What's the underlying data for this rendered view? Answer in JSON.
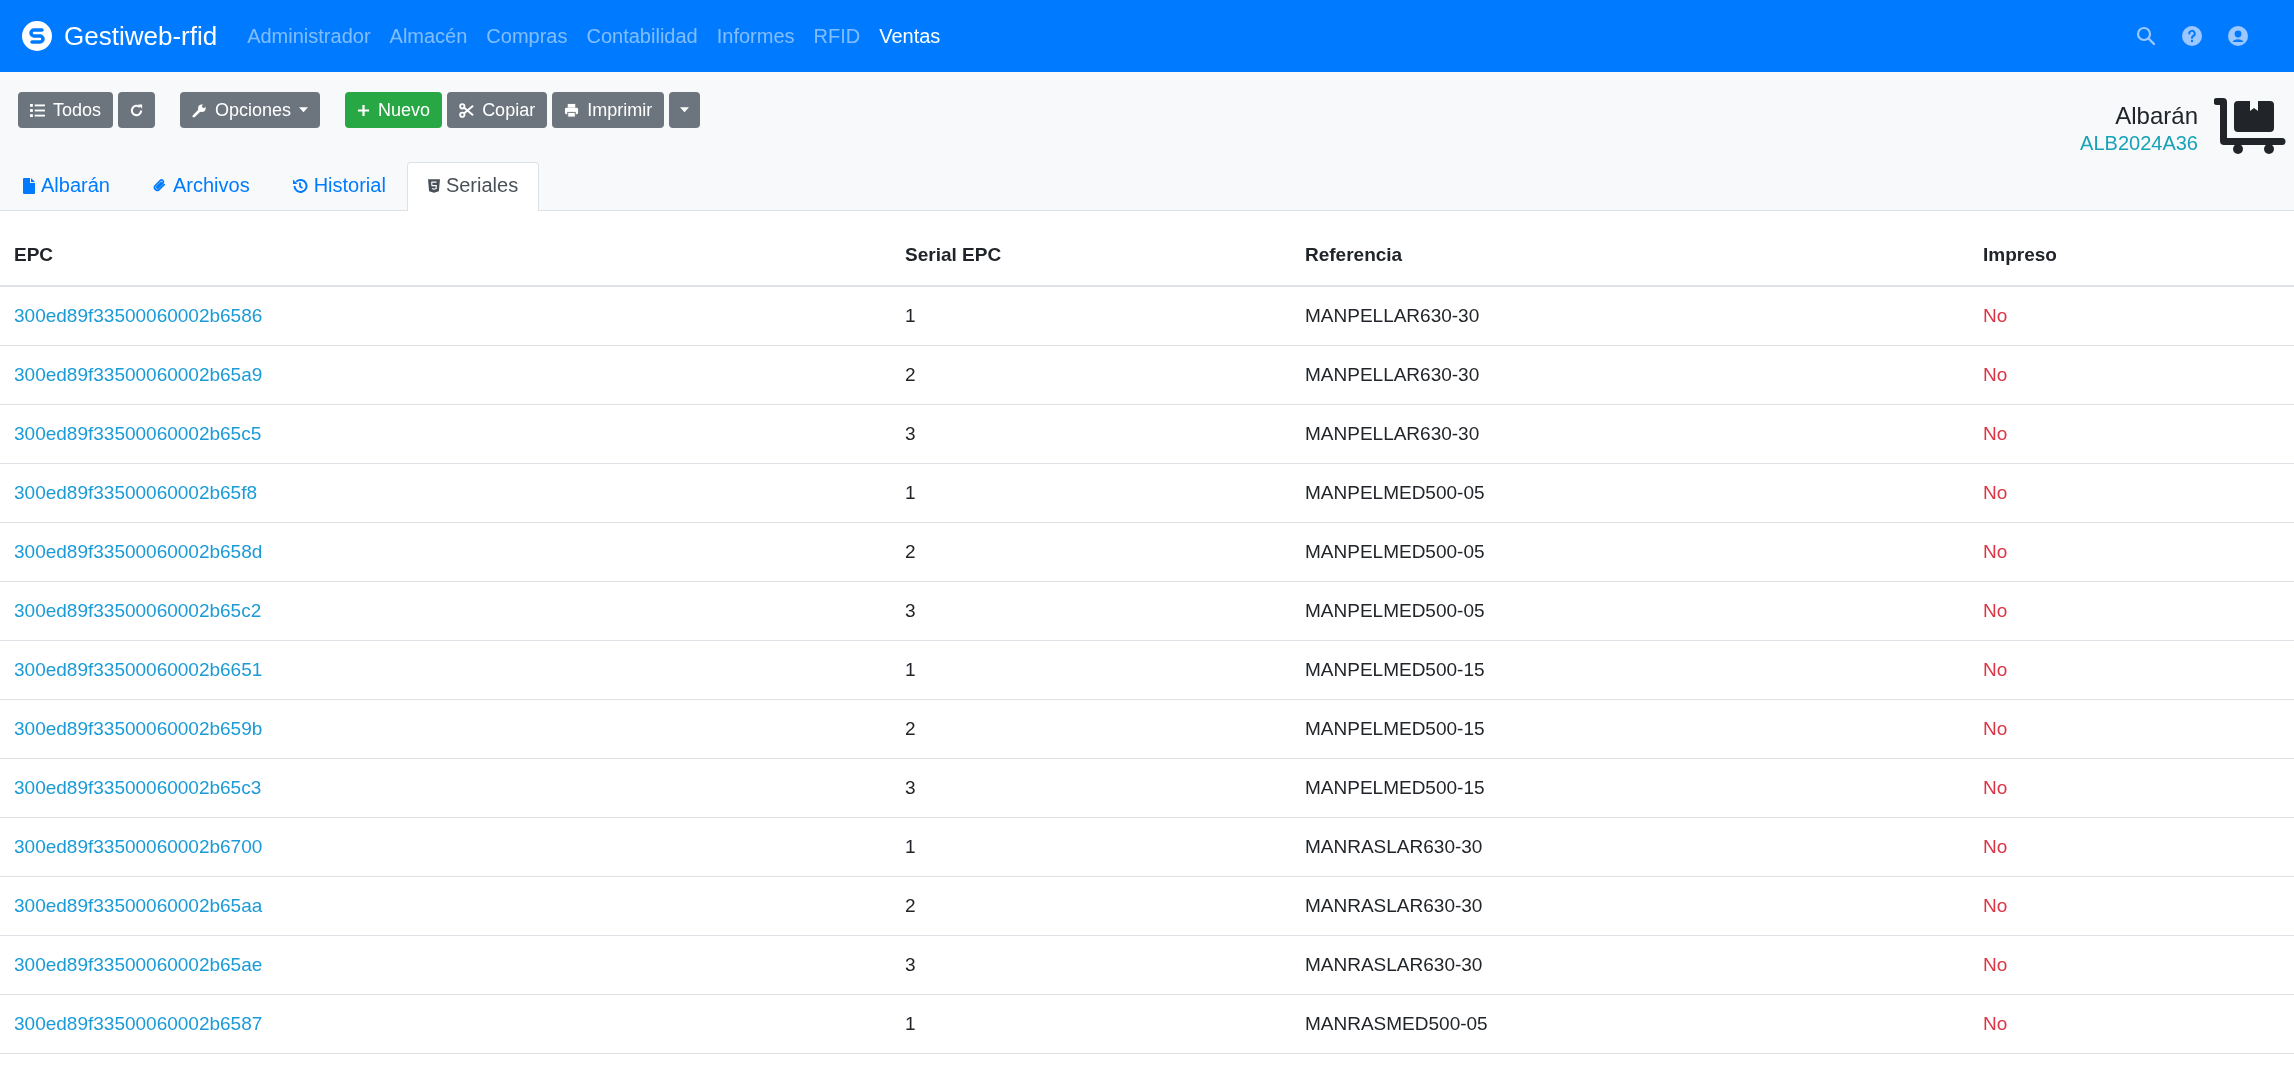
{
  "navbar": {
    "brand": "Gestiweb-rfid",
    "items": [
      {
        "label": "Administrador",
        "selected": false
      },
      {
        "label": "Almacén",
        "selected": false
      },
      {
        "label": "Compras",
        "selected": false
      },
      {
        "label": "Contabilidad",
        "selected": false
      },
      {
        "label": "Informes",
        "selected": false
      },
      {
        "label": "RFID",
        "selected": false
      },
      {
        "label": "Ventas",
        "selected": true
      }
    ]
  },
  "toolbar": {
    "groups": [
      {
        "buttons": [
          {
            "kind": "list",
            "label": "Todos"
          },
          {
            "kind": "refresh"
          }
        ]
      },
      {
        "buttons": [
          {
            "kind": "options",
            "label": "Opciones"
          }
        ]
      },
      {
        "buttons": [
          {
            "kind": "new",
            "label": "Nuevo"
          },
          {
            "kind": "copy",
            "label": "Copiar"
          },
          {
            "kind": "print",
            "label": "Imprimir"
          },
          {
            "kind": "caret"
          }
        ]
      }
    ]
  },
  "document": {
    "title": "Albarán",
    "code": "ALB2024A36"
  },
  "tabs": [
    {
      "kind": "file",
      "label": "Albarán",
      "selected": false
    },
    {
      "kind": "clip",
      "label": "Archivos",
      "selected": false
    },
    {
      "kind": "history",
      "label": "Historial",
      "selected": false
    },
    {
      "kind": "html5",
      "label": "Seriales",
      "selected": true
    }
  ],
  "table": {
    "columns": [
      "EPC",
      "Serial EPC",
      "Referencia",
      "Impreso"
    ],
    "rows": [
      [
        "300ed89f33500060002b6586",
        "1",
        "MANPELLAR630-30",
        "No"
      ],
      [
        "300ed89f33500060002b65a9",
        "2",
        "MANPELLAR630-30",
        "No"
      ],
      [
        "300ed89f33500060002b65c5",
        "3",
        "MANPELLAR630-30",
        "No"
      ],
      [
        "300ed89f33500060002b65f8",
        "1",
        "MANPELMED500-05",
        "No"
      ],
      [
        "300ed89f33500060002b658d",
        "2",
        "MANPELMED500-05",
        "No"
      ],
      [
        "300ed89f33500060002b65c2",
        "3",
        "MANPELMED500-05",
        "No"
      ],
      [
        "300ed89f33500060002b6651",
        "1",
        "MANPELMED500-15",
        "No"
      ],
      [
        "300ed89f33500060002b659b",
        "2",
        "MANPELMED500-15",
        "No"
      ],
      [
        "300ed89f33500060002b65c3",
        "3",
        "MANPELMED500-15",
        "No"
      ],
      [
        "300ed89f33500060002b6700",
        "1",
        "MANRASLAR630-30",
        "No"
      ],
      [
        "300ed89f33500060002b65aa",
        "2",
        "MANRASLAR630-30",
        "No"
      ],
      [
        "300ed89f33500060002b65ae",
        "3",
        "MANRASLAR630-30",
        "No"
      ],
      [
        "300ed89f33500060002b6587",
        "1",
        "MANRASMED500-05",
        "No"
      ]
    ]
  }
}
